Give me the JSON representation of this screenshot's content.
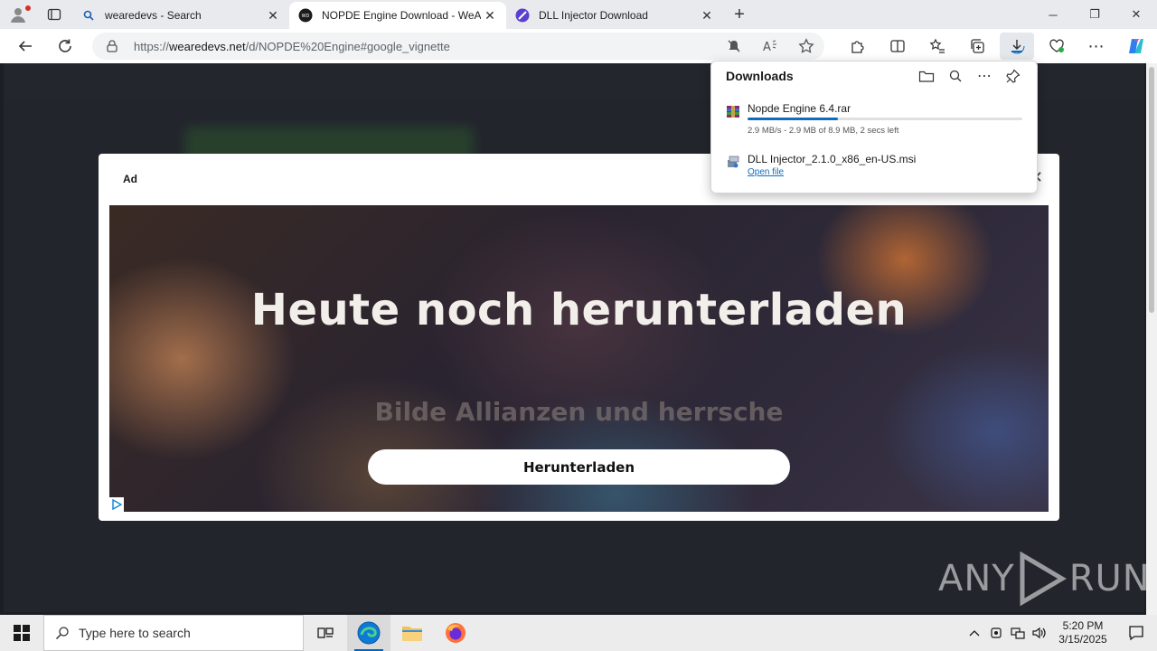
{
  "browser": {
    "tabs": [
      {
        "title": "wearedevs - Search",
        "active": false
      },
      {
        "title": "NOPDE Engine Download - WeAreDevs",
        "active": true
      },
      {
        "title": "DLL Injector Download",
        "active": false
      }
    ],
    "url": {
      "prefix": "https://",
      "host": "wearedevs.net",
      "path": "/d/NOPDE%20Engine#google_vignette"
    }
  },
  "downloads": {
    "title": "Downloads",
    "items": [
      {
        "name": "Nopde Engine 6.4.rar",
        "progress": 0.33,
        "status": "2.9 MB/s - 2.9 MB of 8.9 MB, 2 secs left"
      },
      {
        "name": "DLL Injector_2.1.0_x86_en-US.msi",
        "action": "Open file"
      }
    ]
  },
  "ad": {
    "label": "Ad",
    "headline": "Heute noch herunterladen",
    "subline": "Bilde Allianzen und herrsche",
    "button": "Herunterladen"
  },
  "watermark": "ANY RUN",
  "taskbar": {
    "search_placeholder": "Type here to search",
    "time": "5:20 PM",
    "date": "3/15/2025"
  },
  "colors": {
    "accent": "#0f6cbd",
    "taskbar": "#ececec",
    "modal": "#ffffff"
  }
}
